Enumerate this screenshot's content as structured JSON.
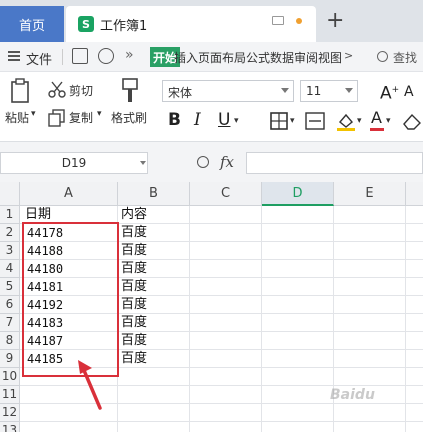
{
  "tabs": {
    "home_label": "首页",
    "doc_icon": "S",
    "doc_title": "工作簿1"
  },
  "menu": {
    "file": "文件",
    "start": "开始",
    "tabs_text": "插入页面布局公式数据审阅视图",
    "search": "查找"
  },
  "ribbon": {
    "paste": "粘贴",
    "cut": "剪切",
    "copy": "复制",
    "format_painter": "格式刷",
    "font_name": "宋体",
    "font_size": "11",
    "bold": "B",
    "italic": "I",
    "underline": "U",
    "grow": "A",
    "shrink": "A",
    "font_color": "A"
  },
  "formula_bar": {
    "cell_ref": "D19",
    "fx": "fx"
  },
  "sheet": {
    "columns": [
      "A",
      "B",
      "C",
      "D",
      "E"
    ],
    "selected_column": "D",
    "rows": [
      "1",
      "2",
      "3",
      "4",
      "5",
      "6",
      "7",
      "8",
      "9",
      "10",
      "11",
      "12",
      "13"
    ],
    "a_header": "日期",
    "b_header": "内容",
    "a_values": [
      "44178",
      "44188",
      "44180",
      "44181",
      "44192",
      "44183",
      "44187",
      "44185"
    ],
    "b_values": [
      "百度",
      "百度",
      "百度",
      "百度",
      "百度",
      "百度",
      "百度",
      "百度"
    ]
  },
  "colors": {
    "home_tab": "#4a78c8",
    "accent_green": "#1e9e62",
    "annotation_red": "#d9303a"
  },
  "watermark": "Baidu"
}
